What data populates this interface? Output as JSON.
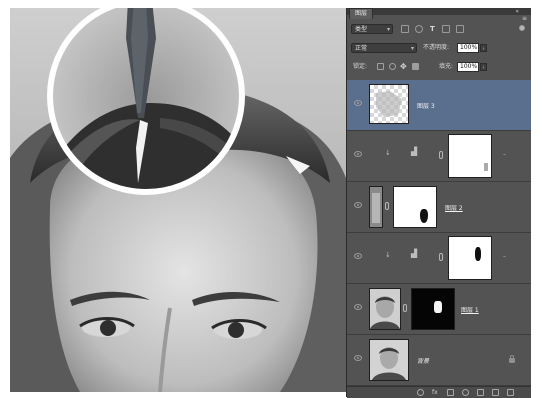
{
  "panel": {
    "tab_label": "图层",
    "close_glyph": "«",
    "menu_glyph": "≡",
    "filter": {
      "kind_label": "类型",
      "icons": [
        "image-filter-icon",
        "adjustment-filter-icon",
        "type-filter-icon",
        "shape-filter-icon",
        "smartobject-filter-icon"
      ]
    },
    "blend_mode": "正常",
    "opacity_label": "不透明度:",
    "opacity_value": "100%",
    "lock_label": "锁定:",
    "fill_label": "填充:",
    "fill_value": "100%",
    "layers": [
      {
        "name": "图层 3",
        "kind": "pixel",
        "selected": true
      },
      {
        "name": "",
        "kind": "adjustment-levels",
        "selected": false
      },
      {
        "name": "图层 2",
        "kind": "pixel-mask",
        "selected": false
      },
      {
        "name": "",
        "kind": "adjustment-levels",
        "selected": false
      },
      {
        "name": "图层 1",
        "kind": "pixel-mask",
        "selected": false
      },
      {
        "name": "背景",
        "kind": "background",
        "selected": false
      }
    ],
    "bottom_icons": [
      "link-layers-icon",
      "fx-icon",
      "add-mask-icon",
      "new-adjustment-icon",
      "new-group-icon",
      "new-layer-icon",
      "delete-icon"
    ]
  },
  "colors": {
    "panel_bg": "#535353",
    "selected_row": "#5a6f8e",
    "loupe_ring": "#ffffff"
  }
}
